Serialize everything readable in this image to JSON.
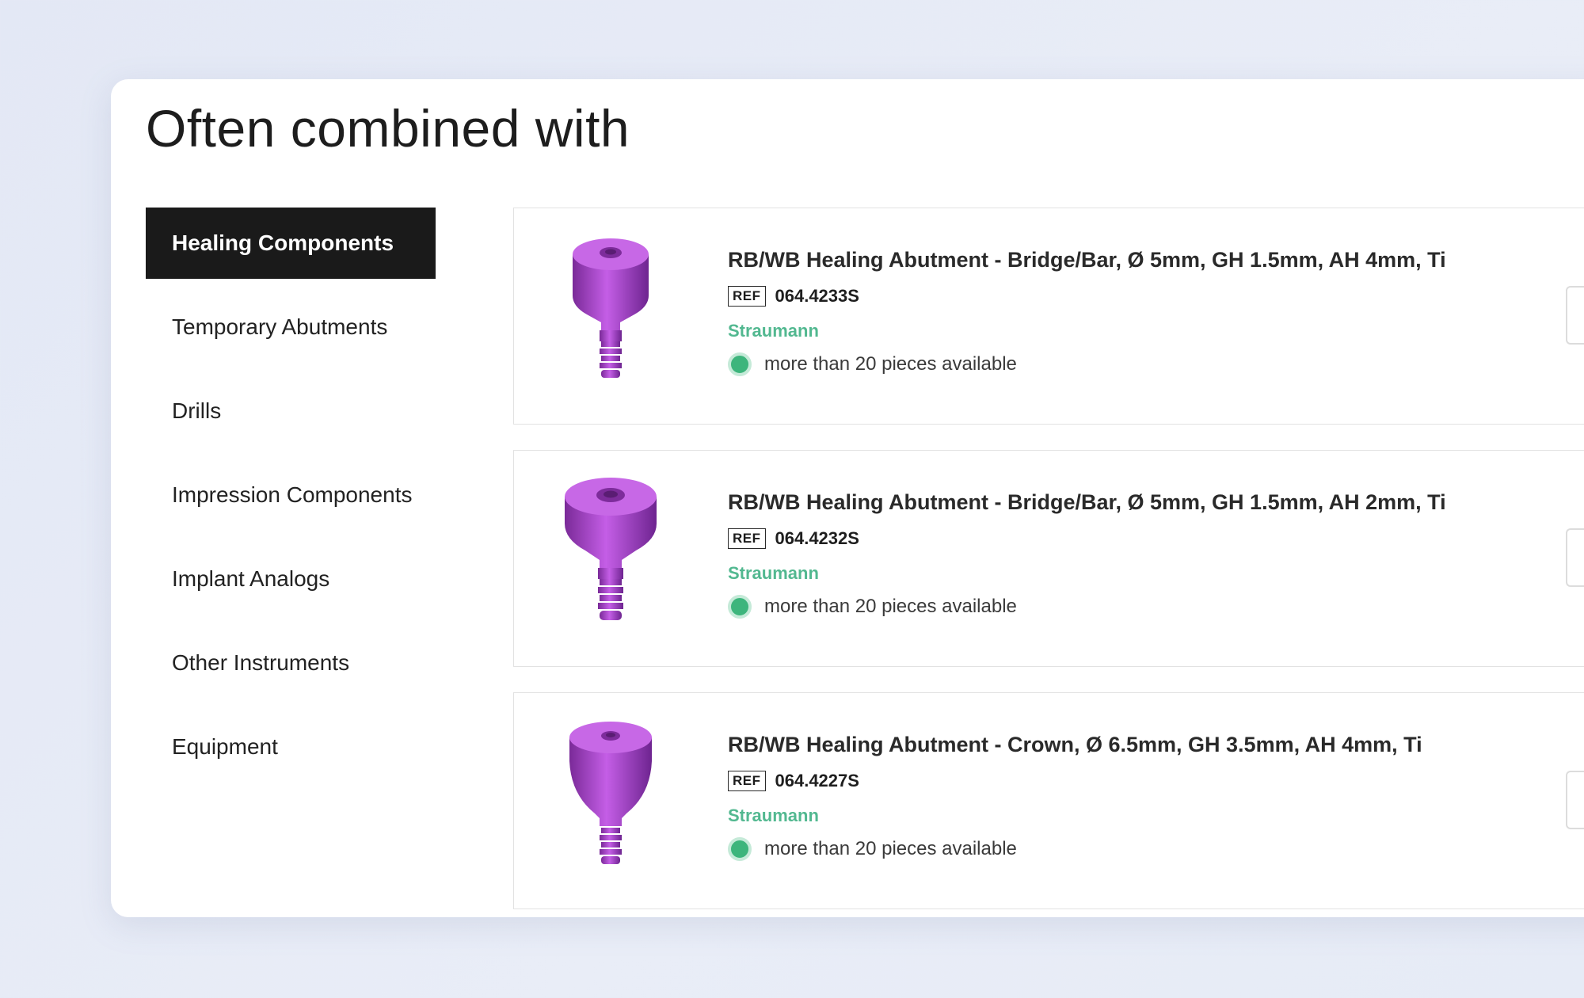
{
  "section_title": "Often combined with",
  "sidebar": {
    "items": [
      {
        "label": "Healing Components",
        "active": true
      },
      {
        "label": "Temporary Abutments",
        "active": false
      },
      {
        "label": "Drills",
        "active": false
      },
      {
        "label": "Impression Components",
        "active": false
      },
      {
        "label": "Implant Analogs",
        "active": false
      },
      {
        "label": "Other Instruments",
        "active": false
      },
      {
        "label": "Equipment",
        "active": false
      }
    ]
  },
  "products": [
    {
      "name": "RB/WB Healing Abutment - Bridge/Bar, Ø 5mm, GH 1.5mm, AH 4mm, Ti",
      "ref_label": "REF",
      "ref": "064.4233S",
      "brand": "Straumann",
      "stock": "more than 20 pieces available",
      "image_icon": "healing-abutment-tall"
    },
    {
      "name": "RB/WB Healing Abutment - Bridge/Bar, Ø 5mm, GH 1.5mm, AH 2mm, Ti",
      "ref_label": "REF",
      "ref": "064.4232S",
      "brand": "Straumann",
      "stock": "more than 20 pieces available",
      "image_icon": "healing-abutment-wide"
    },
    {
      "name": "RB/WB Healing Abutment - Crown, Ø 6.5mm, GH 3.5mm, AH 4mm, Ti",
      "ref_label": "REF",
      "ref": "064.4227S",
      "brand": "Straumann",
      "stock": "more than 20 pieces available",
      "image_icon": "healing-abutment-crown"
    }
  ],
  "colors": {
    "brand_green": "#52b890",
    "stock_green": "#3db57c",
    "product_purple": "#b04fd0",
    "active_tab_bg": "#1a1a1a"
  }
}
